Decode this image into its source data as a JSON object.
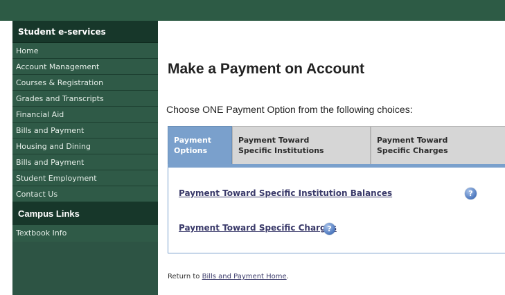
{
  "sidebar": {
    "heading": "Student e-services",
    "items": [
      {
        "label": "Home"
      },
      {
        "label": "Account Management"
      },
      {
        "label": "Courses & Registration"
      },
      {
        "label": "Grades and Transcripts"
      },
      {
        "label": "Financial Aid"
      },
      {
        "label": "Bills and Payment"
      },
      {
        "label": "Housing and Dining"
      },
      {
        "label": "Bills and Payment"
      },
      {
        "label": "Student Employment"
      },
      {
        "label": "Contact Us"
      }
    ],
    "campus_heading": "Campus Links",
    "campus_items": [
      {
        "label": "Textbook Info"
      }
    ]
  },
  "main": {
    "title": "Make a Payment on Account",
    "subtitle": "Choose ONE Payment Option from the following choices:",
    "tabs": [
      {
        "line1": "Payment",
        "line2": "Options",
        "active": true
      },
      {
        "line1": "Payment Toward",
        "line2": "Specific Institutions",
        "active": false
      },
      {
        "line1": "Payment Toward",
        "line2": "Specific Charges",
        "active": false
      }
    ],
    "links": [
      {
        "label": "Payment Toward Specific Institution Balances"
      },
      {
        "label": "Payment Toward Specific Charges"
      }
    ],
    "help_glyph": "?",
    "return_prefix": "Return to ",
    "return_link": "Bills and Payment Home",
    "return_suffix": "."
  },
  "colors": {
    "sidebar": "#2d5444",
    "sidebar_heading": "#17372a",
    "active_tab": "#7aa0cc",
    "inactive_tab": "#d6d6d6",
    "link": "#3a3a6a"
  }
}
